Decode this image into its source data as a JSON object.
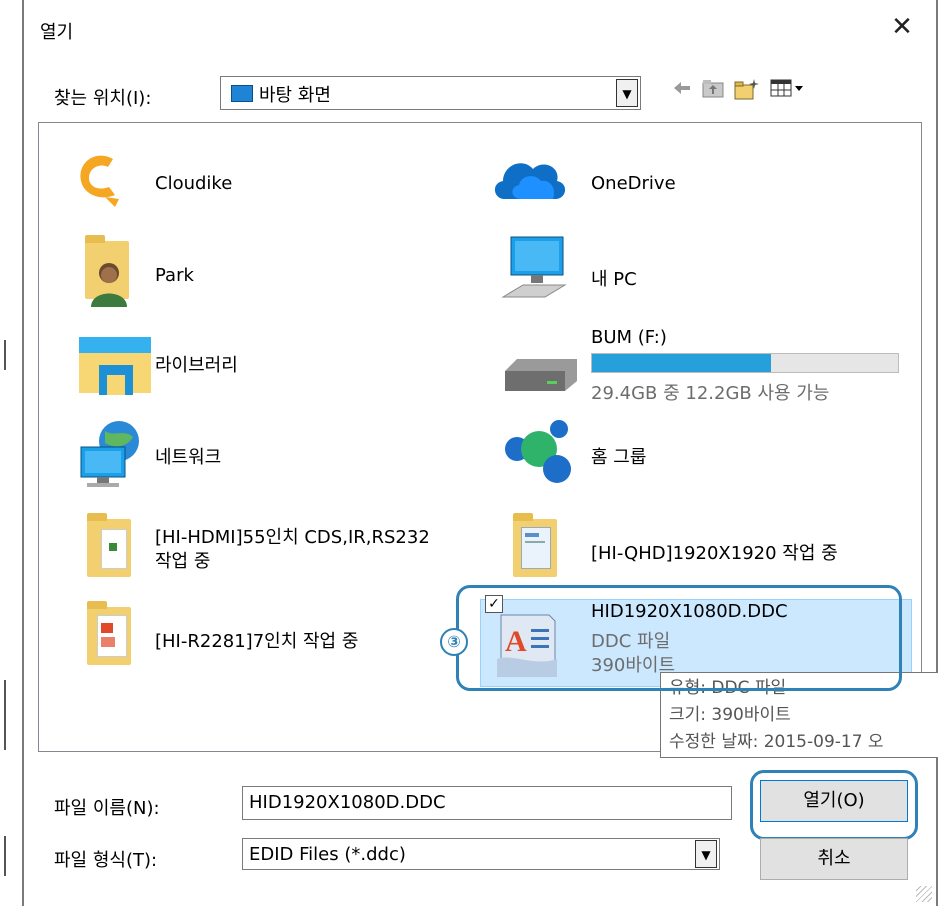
{
  "dialog": {
    "title": "열기",
    "close_glyph": "✕"
  },
  "look_in": {
    "label": "찾는 위치(I):",
    "value": "바탕 화면",
    "dropdown_glyph": "▼"
  },
  "toolbar": {
    "back_icon": "arrow-left-icon",
    "up_icon": "folder-up-icon",
    "new_folder_icon": "new-folder-icon",
    "view_menu_icon": "view-menu-icon"
  },
  "items": [
    {
      "label": "Cloudike",
      "icon": "cloudike-icon"
    },
    {
      "label": "OneDrive",
      "icon": "onedrive-icon"
    },
    {
      "label": "Park",
      "icon": "user-folder-icon"
    },
    {
      "label": "내 PC",
      "icon": "computer-icon"
    },
    {
      "label": "라이브러리",
      "icon": "library-icon"
    },
    {
      "label": "BUM (F:)",
      "icon": "drive-icon",
      "usage_text": "29.4GB 중 12.2GB 사용 가능",
      "used_fraction": 0.585
    },
    {
      "label": "네트워크",
      "icon": "network-icon"
    },
    {
      "label": "홈 그룹",
      "icon": "homegroup-icon"
    },
    {
      "label": "[HI-HDMI]55인치 CDS,IR,RS232",
      "label2": "작업 중",
      "icon": "folder-icon"
    },
    {
      "label": "[HI-QHD]1920X1920  작업 중",
      "icon": "folder-icon"
    },
    {
      "label": "[HI-R2281]7인치 작업 중",
      "icon": "folder-icon"
    },
    {
      "label": "HID1920X1080D.DDC",
      "type": "DDC 파일",
      "size": "390바이트",
      "icon": "document-file-icon"
    }
  ],
  "tooltip": {
    "line1": "유형: DDC 파일",
    "line2": "크기: 390바이트",
    "line3": "수정한 날짜: 2015-09-17 오"
  },
  "annotation": {
    "step": "③",
    "color": "#2f82b5"
  },
  "file_name": {
    "label": "파일 이름(N):",
    "value": "HID1920X1080D.DDC"
  },
  "file_type": {
    "label": "파일 형식(T):",
    "value": "EDID Files (*.ddc)",
    "dropdown_glyph": "▼"
  },
  "buttons": {
    "open": "열기(O)",
    "cancel": "취소"
  }
}
